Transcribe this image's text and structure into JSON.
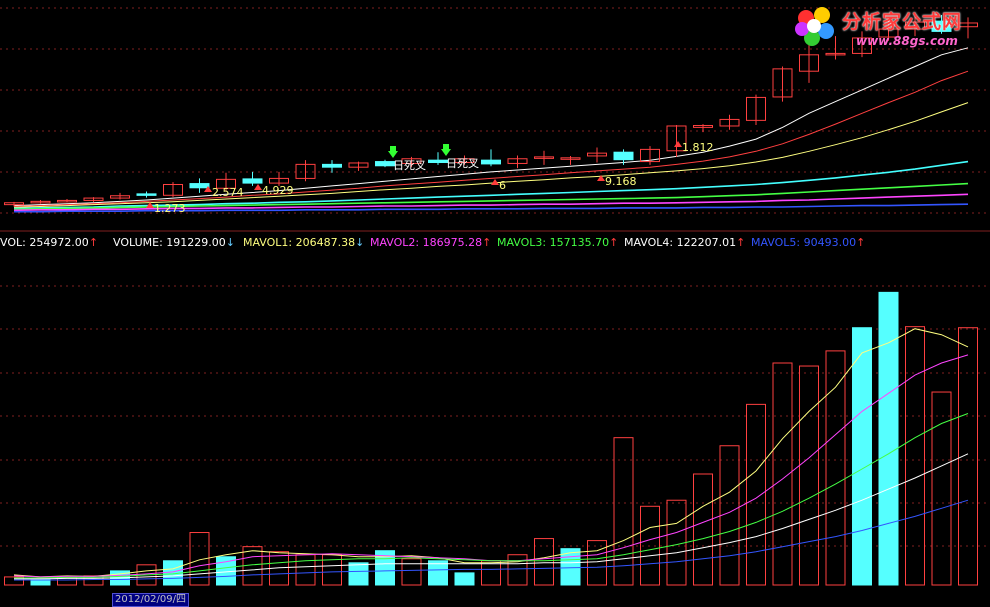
{
  "logo": {
    "title": "分析家公式网",
    "url": "www.88gs.com"
  },
  "volume_legend": [
    {
      "label": "VOL",
      "value": "254972.00",
      "color": "#ffffff",
      "arrow": "↑",
      "arrow_dir": "up"
    },
    {
      "label": "VOLUME",
      "value": "191229.00",
      "color": "#ffffff",
      "arrow": "↓",
      "arrow_dir": "down"
    },
    {
      "label": "MAVOL1",
      "value": "206487.38",
      "color": "#ffff80",
      "arrow": "↓",
      "arrow_dir": "down"
    },
    {
      "label": "MAVOL2",
      "value": "186975.28",
      "color": "#ff44ff",
      "arrow": "↑",
      "arrow_dir": "up"
    },
    {
      "label": "MAVOL3",
      "value": "157135.70",
      "color": "#44ff44",
      "arrow": "↑",
      "arrow_dir": "up"
    },
    {
      "label": "MAVOL4",
      "value": "122207.01",
      "color": "#ffffff",
      "arrow": "↑",
      "arrow_dir": "up"
    },
    {
      "label": "MAVOL5",
      "value": "90493.00",
      "color": "#3355ff",
      "arrow": "↑",
      "arrow_dir": "up"
    }
  ],
  "date_label": "2012/02/09/四",
  "colors": {
    "up_bar": "#ff4040",
    "down_bar": "#55ffff",
    "grid": "#802020",
    "background": "#000000"
  },
  "chart_data": [
    {
      "type": "candlestick",
      "annotations": [
        "日死叉",
        "日死叉"
      ],
      "price_labels": [
        "1.273",
        "2.574",
        "4.929",
        "1.812",
        "9.168",
        "6"
      ],
      "candles": [
        {
          "open": 2.0,
          "high": 2.6,
          "low": 1.6,
          "close": 2.4
        },
        {
          "open": 2.4,
          "high": 3.0,
          "low": 2.2,
          "close": 2.7
        },
        {
          "open": 2.7,
          "high": 3.2,
          "low": 2.5,
          "close": 2.9
        },
        {
          "open": 2.9,
          "high": 3.6,
          "low": 2.6,
          "close": 3.4
        },
        {
          "open": 3.4,
          "high": 4.5,
          "low": 3.1,
          "close": 3.9
        },
        {
          "open": 4.3,
          "high": 4.8,
          "low": 3.5,
          "close": 4.0
        },
        {
          "open": 4.0,
          "high": 6.8,
          "low": 3.6,
          "close": 6.3
        },
        {
          "open": 6.5,
          "high": 7.6,
          "low": 4.5,
          "close": 5.6
        },
        {
          "open": 5.5,
          "high": 8.8,
          "low": 5.0,
          "close": 7.4
        },
        {
          "open": 7.5,
          "high": 9.0,
          "low": 6.0,
          "close": 6.6
        },
        {
          "open": 6.6,
          "high": 9.0,
          "low": 6.0,
          "close": 7.6
        },
        {
          "open": 7.6,
          "high": 11.5,
          "low": 7.0,
          "close": 10.6
        },
        {
          "open": 10.6,
          "high": 11.5,
          "low": 8.8,
          "close": 10.0
        },
        {
          "open": 10.0,
          "high": 11.2,
          "low": 9.2,
          "close": 10.9
        },
        {
          "open": 11.2,
          "high": 11.6,
          "low": 10.0,
          "close": 10.3
        },
        {
          "open": 10.8,
          "high": 12.2,
          "low": 10.0,
          "close": 11.8
        },
        {
          "open": 11.5,
          "high": 13.2,
          "low": 10.5,
          "close": 11.0
        },
        {
          "open": 11.0,
          "high": 12.5,
          "low": 10.5,
          "close": 11.8
        },
        {
          "open": 11.5,
          "high": 13.8,
          "low": 10.2,
          "close": 10.7
        },
        {
          "open": 10.8,
          "high": 12.5,
          "low": 9.8,
          "close": 11.8
        },
        {
          "open": 12.0,
          "high": 13.5,
          "low": 10.5,
          "close": 12.2
        },
        {
          "open": 12.0,
          "high": 12.4,
          "low": 10.5,
          "close": 12.0
        },
        {
          "open": 12.4,
          "high": 14.2,
          "low": 11.0,
          "close": 13.0
        },
        {
          "open": 13.2,
          "high": 13.8,
          "low": 10.5,
          "close": 11.6
        },
        {
          "open": 11.2,
          "high": 14.5,
          "low": 10.5,
          "close": 13.8
        },
        {
          "open": 13.5,
          "high": 19.0,
          "low": 12.2,
          "close": 18.8
        },
        {
          "open": 18.5,
          "high": 19.2,
          "low": 17.5,
          "close": 18.9
        },
        {
          "open": 18.8,
          "high": 21.2,
          "low": 18.0,
          "close": 20.2
        },
        {
          "open": 20.0,
          "high": 25.5,
          "low": 19.0,
          "close": 24.9
        },
        {
          "open": 25.0,
          "high": 31.5,
          "low": 24.0,
          "close": 31.0
        },
        {
          "open": 30.5,
          "high": 36.5,
          "low": 28.0,
          "close": 34.0
        },
        {
          "open": 34.0,
          "high": 38.0,
          "low": 33.0,
          "close": 34.3
        },
        {
          "open": 34.3,
          "high": 39.0,
          "low": 33.5,
          "close": 37.6
        },
        {
          "open": 37.8,
          "high": 41.5,
          "low": 37.0,
          "close": 39.5
        },
        {
          "open": 39.5,
          "high": 43.0,
          "low": 38.0,
          "close": 41.0
        },
        {
          "open": 41.2,
          "high": 42.5,
          "low": 38.5,
          "close": 39.0
        },
        {
          "open": 40.0,
          "high": 42.0,
          "low": 37.5,
          "close": 40.8
        }
      ],
      "ma_lines": [
        {
          "color": "#ffffff",
          "values": [
            1.8,
            2.0,
            2.2,
            2.4,
            2.7,
            3.0,
            3.4,
            3.8,
            4.2,
            4.6,
            5.0,
            5.5,
            6.0,
            6.5,
            7.0,
            7.5,
            8.0,
            8.5,
            9.0,
            9.4,
            9.8,
            10.2,
            10.6,
            11.0,
            11.5,
            12.3,
            13.2,
            14.5,
            16.0,
            18.5,
            21.5,
            24.0,
            26.5,
            29.0,
            31.5,
            34.0,
            35.5
          ]
        },
        {
          "color": "#ff4040",
          "values": [
            1.6,
            1.8,
            2.0,
            2.2,
            2.4,
            2.7,
            3.0,
            3.3,
            3.6,
            4.0,
            4.3,
            4.7,
            5.1,
            5.5,
            6.0,
            6.4,
            6.8,
            7.2,
            7.6,
            8.0,
            8.4,
            8.8,
            9.2,
            9.6,
            10.0,
            10.6,
            11.3,
            12.2,
            13.4,
            15.0,
            17.0,
            19.2,
            21.5,
            23.8,
            26.0,
            28.5,
            30.5
          ]
        },
        {
          "color": "#ffff80",
          "values": [
            1.4,
            1.6,
            1.8,
            2.0,
            2.2,
            2.4,
            2.6,
            2.9,
            3.2,
            3.5,
            3.8,
            4.1,
            4.4,
            4.8,
            5.2,
            5.5,
            5.9,
            6.2,
            6.6,
            7.0,
            7.3,
            7.7,
            8.0,
            8.4,
            8.8,
            9.2,
            9.7,
            10.3,
            11.1,
            12.1,
            13.4,
            14.8,
            16.3,
            18.0,
            19.8,
            21.8,
            23.8
          ]
        },
        {
          "color": "#44ffff",
          "values": [
            1.2,
            1.3,
            1.4,
            1.5,
            1.7,
            1.8,
            1.9,
            2.0,
            2.2,
            2.3,
            2.5,
            2.6,
            2.8,
            3.0,
            3.2,
            3.4,
            3.6,
            3.8,
            4.0,
            4.2,
            4.4,
            4.6,
            4.8,
            5.0,
            5.2,
            5.4,
            5.7,
            6.0,
            6.3,
            6.7,
            7.2,
            7.7,
            8.3,
            8.9,
            9.6,
            10.4,
            11.2
          ]
        },
        {
          "color": "#44ff44",
          "values": [
            1.0,
            1.1,
            1.2,
            1.3,
            1.4,
            1.5,
            1.6,
            1.7,
            1.8,
            1.9,
            2.0,
            2.1,
            2.2,
            2.3,
            2.4,
            2.5,
            2.6,
            2.7,
            2.8,
            2.9,
            3.0,
            3.1,
            3.2,
            3.3,
            3.4,
            3.5,
            3.7,
            3.9,
            4.1,
            4.4,
            4.7,
            5.0,
            5.3,
            5.6,
            5.9,
            6.2,
            6.5
          ]
        },
        {
          "color": "#ff44ff",
          "values": [
            0.8,
            0.9,
            0.9,
            1.0,
            1.0,
            1.1,
            1.2,
            1.2,
            1.3,
            1.3,
            1.4,
            1.5,
            1.5,
            1.6,
            1.7,
            1.7,
            1.8,
            1.9,
            1.9,
            2.0,
            2.1,
            2.1,
            2.2,
            2.3,
            2.3,
            2.4,
            2.5,
            2.6,
            2.7,
            2.9,
            3.0,
            3.2,
            3.4,
            3.6,
            3.8,
            4.0,
            4.2
          ]
        },
        {
          "color": "#3355ff",
          "values": [
            0.5,
            0.5,
            0.6,
            0.6,
            0.6,
            0.7,
            0.7,
            0.7,
            0.8,
            0.8,
            0.8,
            0.9,
            0.9,
            0.9,
            1.0,
            1.0,
            1.0,
            1.1,
            1.1,
            1.1,
            1.2,
            1.2,
            1.2,
            1.3,
            1.3,
            1.3,
            1.4,
            1.4,
            1.5,
            1.5,
            1.6,
            1.7,
            1.8,
            1.8,
            1.9,
            2.0,
            2.1
          ]
        }
      ]
    },
    {
      "type": "bar",
      "ylim": [
        0,
        330000
      ],
      "volumes": [
        {
          "v": 8000,
          "up": true
        },
        {
          "v": 6000,
          "up": false
        },
        {
          "v": 7500,
          "up": true
        },
        {
          "v": 9000,
          "up": true
        },
        {
          "v": 14000,
          "up": false
        },
        {
          "v": 20000,
          "up": true
        },
        {
          "v": 24000,
          "up": false
        },
        {
          "v": 52000,
          "up": true
        },
        {
          "v": 28000,
          "up": false
        },
        {
          "v": 38000,
          "up": true
        },
        {
          "v": 33000,
          "up": true
        },
        {
          "v": 30000,
          "up": true
        },
        {
          "v": 30000,
          "up": true
        },
        {
          "v": 22000,
          "up": false
        },
        {
          "v": 34000,
          "up": false
        },
        {
          "v": 26000,
          "up": true
        },
        {
          "v": 24000,
          "up": false
        },
        {
          "v": 12000,
          "up": false
        },
        {
          "v": 24000,
          "up": true
        },
        {
          "v": 30000,
          "up": true
        },
        {
          "v": 46000,
          "up": true
        },
        {
          "v": 36000,
          "up": false
        },
        {
          "v": 44000,
          "up": true
        },
        {
          "v": 146000,
          "up": true
        },
        {
          "v": 78000,
          "up": true
        },
        {
          "v": 84000,
          "up": true
        },
        {
          "v": 110000,
          "up": true
        },
        {
          "v": 138000,
          "up": true
        },
        {
          "v": 179000,
          "up": true
        },
        {
          "v": 220000,
          "up": true
        },
        {
          "v": 217000,
          "up": true
        },
        {
          "v": 232000,
          "up": true
        },
        {
          "v": 254972,
          "up": false
        },
        {
          "v": 290000,
          "up": false
        },
        {
          "v": 256000,
          "up": true
        },
        {
          "v": 191229,
          "up": true
        },
        {
          "v": 254972,
          "up": true
        }
      ],
      "mavol_lines": [
        {
          "name": "MAVOL1",
          "color": "#ffff80",
          "values": [
            10000,
            8000,
            9000,
            8500,
            11000,
            14000,
            16000,
            25000,
            30000,
            34000,
            32000,
            31000,
            30000,
            28000,
            28000,
            29000,
            27000,
            22000,
            22000,
            23000,
            27000,
            32000,
            34000,
            44000,
            57000,
            61000,
            78000,
            92000,
            113000,
            145000,
            172000,
            196000,
            230000,
            240000,
            254000,
            248000,
            236000
          ]
        },
        {
          "name": "MAVOL2",
          "color": "#ff44ff",
          "values": [
            9000,
            8000,
            8500,
            8500,
            9500,
            11000,
            13000,
            19000,
            23000,
            28000,
            29000,
            30000,
            31000,
            30000,
            29000,
            28000,
            27000,
            26000,
            24000,
            24000,
            26000,
            28000,
            30000,
            37000,
            45000,
            52000,
            62000,
            72000,
            86000,
            105000,
            126000,
            149000,
            172000,
            190000,
            208000,
            220000,
            228000
          ]
        },
        {
          "name": "MAVOL3",
          "color": "#44ff44",
          "values": [
            7000,
            7000,
            7500,
            7500,
            8500,
            10000,
            11000,
            14000,
            17000,
            20000,
            22000,
            24000,
            25000,
            26000,
            26000,
            27000,
            26000,
            25000,
            24000,
            24000,
            24000,
            25000,
            26000,
            30000,
            35000,
            40000,
            46000,
            53000,
            62000,
            73000,
            86000,
            100000,
            115000,
            130000,
            146000,
            160000,
            170000
          ]
        },
        {
          "name": "MAVOL4",
          "color": "#ffffff",
          "values": [
            6000,
            6000,
            6500,
            6500,
            7000,
            8000,
            9000,
            11000,
            13000,
            15000,
            17000,
            18000,
            19000,
            20000,
            21000,
            21000,
            21000,
            21000,
            21000,
            21000,
            22000,
            22000,
            23000,
            26000,
            29000,
            32000,
            37000,
            42000,
            48000,
            56000,
            65000,
            74000,
            84000,
            95000,
            106000,
            118000,
            130000
          ]
        },
        {
          "name": "MAVOL5",
          "color": "#3355ff",
          "values": [
            5000,
            5000,
            5000,
            5500,
            5500,
            6000,
            6500,
            7500,
            8500,
            10000,
            11000,
            12000,
            13000,
            13500,
            14000,
            14500,
            15000,
            15500,
            15500,
            16000,
            16500,
            17000,
            17500,
            19000,
            21000,
            23000,
            26000,
            29000,
            33000,
            38000,
            43000,
            48000,
            54000,
            61000,
            68000,
            76000,
            84000
          ]
        }
      ]
    }
  ]
}
